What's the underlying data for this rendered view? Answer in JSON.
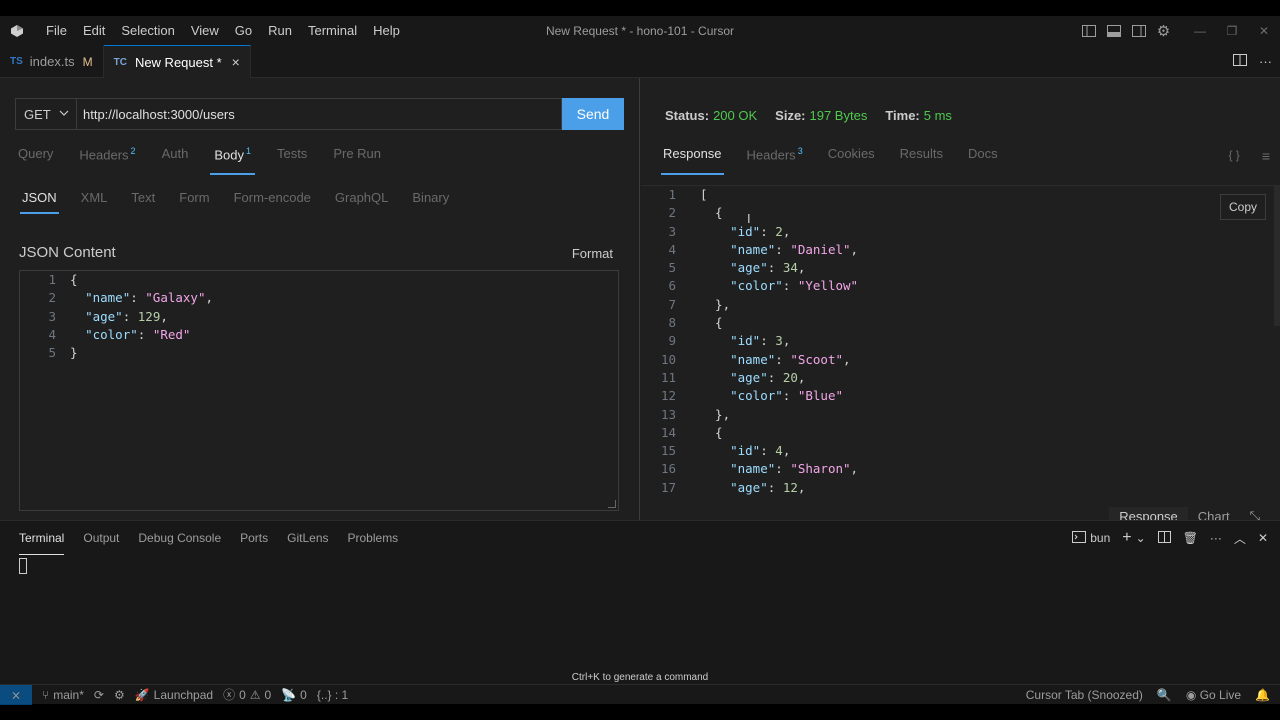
{
  "window": {
    "title": "New Request * - hono-101 - Cursor"
  },
  "menu": [
    "File",
    "Edit",
    "Selection",
    "View",
    "Go",
    "Run",
    "Terminal",
    "Help"
  ],
  "tabs": [
    {
      "badge": "TS",
      "label": "index.ts",
      "modified": "M"
    },
    {
      "badge": "TC",
      "label": "New Request *",
      "close": "×"
    }
  ],
  "request": {
    "method": "GET",
    "url": "http://localhost:3000/users",
    "send_label": "Send",
    "tabs": [
      {
        "label": "Query",
        "count": ""
      },
      {
        "label": "Headers",
        "count": "2"
      },
      {
        "label": "Auth",
        "count": ""
      },
      {
        "label": "Body",
        "count": "1"
      },
      {
        "label": "Tests",
        "count": ""
      },
      {
        "label": "Pre Run",
        "count": ""
      }
    ],
    "body_tabs": [
      "JSON",
      "XML",
      "Text",
      "Form",
      "Form-encode",
      "GraphQL",
      "Binary"
    ],
    "json_heading": "JSON Content",
    "format_label": "Format",
    "body_lines": [
      {
        "n": "1",
        "parts": [
          [
            "p",
            "{"
          ]
        ]
      },
      {
        "n": "2",
        "parts": [
          [
            "p",
            "  "
          ],
          [
            "k",
            "\"name\""
          ],
          [
            "p",
            ": "
          ],
          [
            "sv",
            "\"Galaxy\""
          ],
          [
            "p",
            ","
          ]
        ]
      },
      {
        "n": "3",
        "parts": [
          [
            "p",
            "  "
          ],
          [
            "k",
            "\"age\""
          ],
          [
            "p",
            ": "
          ],
          [
            "n",
            "129"
          ],
          [
            "p",
            ","
          ]
        ]
      },
      {
        "n": "4",
        "parts": [
          [
            "p",
            "  "
          ],
          [
            "k",
            "\"color\""
          ],
          [
            "p",
            ": "
          ],
          [
            "sv",
            "\"Red\""
          ]
        ]
      },
      {
        "n": "5",
        "parts": [
          [
            "p",
            "}"
          ]
        ]
      }
    ]
  },
  "response": {
    "status_label": "Status:",
    "status_value": "200 OK",
    "size_label": "Size:",
    "size_value": "197 Bytes",
    "time_label": "Time:",
    "time_value": "5 ms",
    "tabs": [
      {
        "label": "Response",
        "count": ""
      },
      {
        "label": "Headers",
        "count": "3"
      },
      {
        "label": "Cookies",
        "count": ""
      },
      {
        "label": "Results",
        "count": ""
      },
      {
        "label": "Docs",
        "count": ""
      }
    ],
    "right_icons": [
      "{ }",
      "≡"
    ],
    "copy_label": "Copy",
    "lines": [
      {
        "n": "1",
        "parts": [
          [
            "p",
            "["
          ]
        ]
      },
      {
        "n": "2",
        "parts": [
          [
            "p",
            "  {"
          ]
        ]
      },
      {
        "n": "3",
        "parts": [
          [
            "p",
            "    "
          ],
          [
            "k",
            "\"id\""
          ],
          [
            "p",
            ": "
          ],
          [
            "n",
            "2"
          ],
          [
            "p",
            ","
          ]
        ]
      },
      {
        "n": "4",
        "parts": [
          [
            "p",
            "    "
          ],
          [
            "k",
            "\"name\""
          ],
          [
            "p",
            ": "
          ],
          [
            "sv",
            "\"Daniel\""
          ],
          [
            "p",
            ","
          ]
        ]
      },
      {
        "n": "5",
        "parts": [
          [
            "p",
            "    "
          ],
          [
            "k",
            "\"age\""
          ],
          [
            "p",
            ": "
          ],
          [
            "n",
            "34"
          ],
          [
            "p",
            ","
          ]
        ]
      },
      {
        "n": "6",
        "parts": [
          [
            "p",
            "    "
          ],
          [
            "k",
            "\"color\""
          ],
          [
            "p",
            ": "
          ],
          [
            "sv",
            "\"Yellow\""
          ]
        ]
      },
      {
        "n": "7",
        "parts": [
          [
            "p",
            "  },"
          ]
        ]
      },
      {
        "n": "8",
        "parts": [
          [
            "p",
            "  {"
          ]
        ]
      },
      {
        "n": "9",
        "parts": [
          [
            "p",
            "    "
          ],
          [
            "k",
            "\"id\""
          ],
          [
            "p",
            ": "
          ],
          [
            "n",
            "3"
          ],
          [
            "p",
            ","
          ]
        ]
      },
      {
        "n": "10",
        "parts": [
          [
            "p",
            "    "
          ],
          [
            "k",
            "\"name\""
          ],
          [
            "p",
            ": "
          ],
          [
            "sv",
            "\"Scoot\""
          ],
          [
            "p",
            ","
          ]
        ]
      },
      {
        "n": "11",
        "parts": [
          [
            "p",
            "    "
          ],
          [
            "k",
            "\"age\""
          ],
          [
            "p",
            ": "
          ],
          [
            "n",
            "20"
          ],
          [
            "p",
            ","
          ]
        ]
      },
      {
        "n": "12",
        "parts": [
          [
            "p",
            "    "
          ],
          [
            "k",
            "\"color\""
          ],
          [
            "p",
            ": "
          ],
          [
            "sv",
            "\"Blue\""
          ]
        ]
      },
      {
        "n": "13",
        "parts": [
          [
            "p",
            "  },"
          ]
        ]
      },
      {
        "n": "14",
        "parts": [
          [
            "p",
            "  {"
          ]
        ]
      },
      {
        "n": "15",
        "parts": [
          [
            "p",
            "    "
          ],
          [
            "k",
            "\"id\""
          ],
          [
            "p",
            ": "
          ],
          [
            "n",
            "4"
          ],
          [
            "p",
            ","
          ]
        ]
      },
      {
        "n": "16",
        "parts": [
          [
            "p",
            "    "
          ],
          [
            "k",
            "\"name\""
          ],
          [
            "p",
            ": "
          ],
          [
            "sv",
            "\"Sharon\""
          ],
          [
            "p",
            ","
          ]
        ]
      },
      {
        "n": "17",
        "parts": [
          [
            "p",
            "    "
          ],
          [
            "k",
            "\"age\""
          ],
          [
            "p",
            ": "
          ],
          [
            "n",
            "12"
          ],
          [
            "p",
            ","
          ]
        ]
      }
    ],
    "view_toggle": [
      "Response",
      "Chart"
    ]
  },
  "panel": {
    "tabs": [
      "Terminal",
      "Output",
      "Debug Console",
      "Ports",
      "GitLens",
      "Problems"
    ],
    "shell_label": "bun",
    "hint": "Ctrl+K to generate a command"
  },
  "statusbar": {
    "branch": "main*",
    "launchpad": "Launchpad",
    "errors": "0",
    "warnings": "0",
    "ports": "0",
    "braces": "{..} : 1",
    "cursor_tab": "Cursor Tab (Snoozed)",
    "go_live": "Go Live"
  },
  "colors": {
    "accent": "#4a9fe8",
    "status_ok": "#4ec94e",
    "json_key": "#9cdcfe",
    "json_string": "#f3a6e8",
    "json_number": "#b5cea8"
  }
}
